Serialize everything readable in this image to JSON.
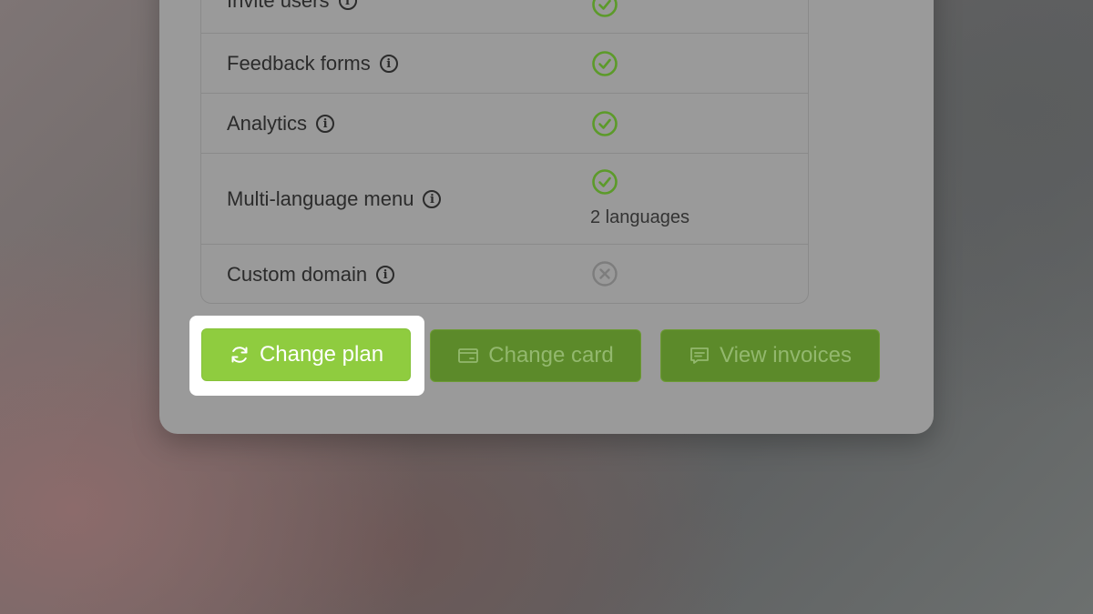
{
  "features": [
    {
      "label": "Invite users",
      "status": "included"
    },
    {
      "label": "Feedback forms",
      "status": "included"
    },
    {
      "label": "Analytics",
      "status": "included"
    },
    {
      "label": "Multi-language menu",
      "status": "included",
      "note": "2 languages"
    },
    {
      "label": "Custom domain",
      "status": "not-included"
    }
  ],
  "actions": {
    "change_plan": "Change plan",
    "change_card": "Change card",
    "view_invoices": "View invoices"
  },
  "icons": {
    "info": "i",
    "included": "check-circle-icon",
    "not_included": "x-circle-icon",
    "change_plan": "refresh-icon",
    "change_card": "credit-card-icon",
    "view_invoices": "message-square-icon"
  },
  "colors": {
    "check": "#5c9a2a",
    "cross": "#7d7d7d",
    "primary": "#8fcc3f",
    "secondary": "#5c8a2a",
    "secondary_text": "#93b86e"
  }
}
